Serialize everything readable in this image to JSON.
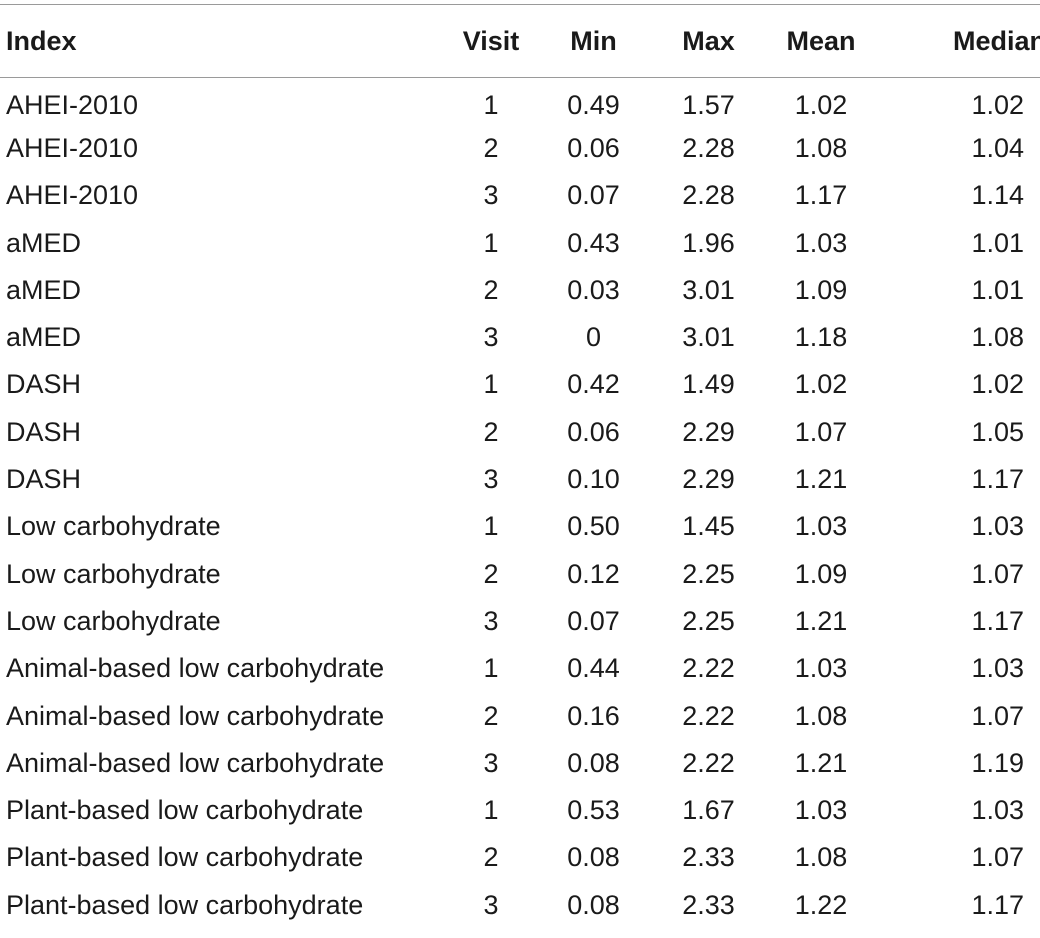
{
  "table": {
    "headers": [
      "Index",
      "Visit",
      "Min",
      "Max",
      "Mean",
      "Median"
    ],
    "rows": [
      [
        "AHEI-2010",
        "1",
        "0.49",
        "1.57",
        "1.02",
        "1.02"
      ],
      [
        "AHEI-2010",
        "2",
        "0.06",
        "2.28",
        "1.08",
        "1.04"
      ],
      [
        "AHEI-2010",
        "3",
        "0.07",
        "2.28",
        "1.17",
        "1.14"
      ],
      [
        "aMED",
        "1",
        "0.43",
        "1.96",
        "1.03",
        "1.01"
      ],
      [
        "aMED",
        "2",
        "0.03",
        "3.01",
        "1.09",
        "1.01"
      ],
      [
        "aMED",
        "3",
        "0",
        "3.01",
        "1.18",
        "1.08"
      ],
      [
        "DASH",
        "1",
        "0.42",
        "1.49",
        "1.02",
        "1.02"
      ],
      [
        "DASH",
        "2",
        "0.06",
        "2.29",
        "1.07",
        "1.05"
      ],
      [
        "DASH",
        "3",
        "0.10",
        "2.29",
        "1.21",
        "1.17"
      ],
      [
        "Low carbohydrate",
        "1",
        "0.50",
        "1.45",
        "1.03",
        "1.03"
      ],
      [
        "Low carbohydrate",
        "2",
        "0.12",
        "2.25",
        "1.09",
        "1.07"
      ],
      [
        "Low carbohydrate",
        "3",
        "0.07",
        "2.25",
        "1.21",
        "1.17"
      ],
      [
        "Animal-based low carbohydrate",
        "1",
        "0.44",
        "2.22",
        "1.03",
        "1.03"
      ],
      [
        "Animal-based low carbohydrate",
        "2",
        "0.16",
        "2.22",
        "1.08",
        "1.07"
      ],
      [
        "Animal-based low carbohydrate",
        "3",
        "0.08",
        "2.22",
        "1.21",
        "1.19"
      ],
      [
        "Plant-based low carbohydrate",
        "1",
        "0.53",
        "1.67",
        "1.03",
        "1.03"
      ],
      [
        "Plant-based low carbohydrate",
        "2",
        "0.08",
        "2.33",
        "1.08",
        "1.07"
      ],
      [
        "Plant-based low carbohydrate",
        "3",
        "0.08",
        "2.33",
        "1.22",
        "1.17"
      ]
    ]
  }
}
